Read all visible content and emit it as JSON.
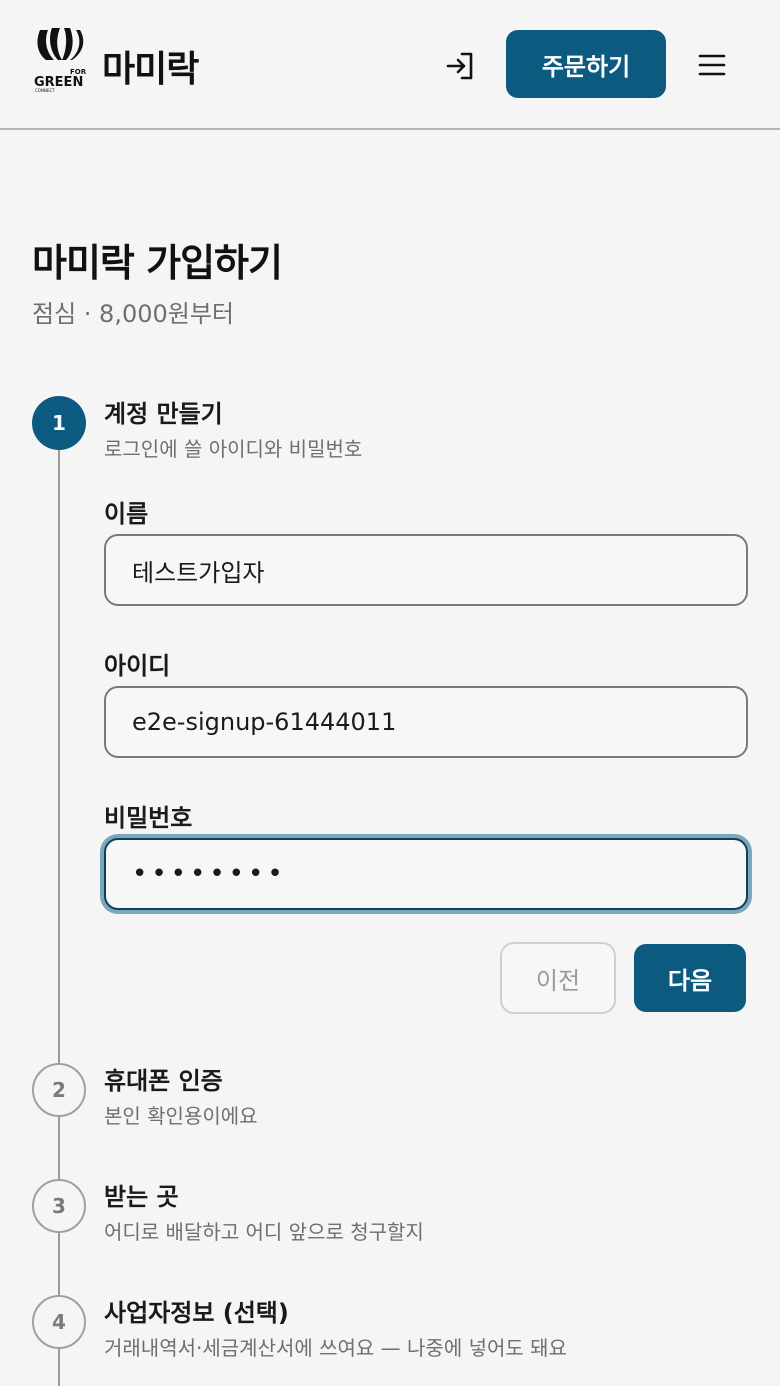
{
  "header": {
    "logo_text": "FOR GREEN CONNECT",
    "brand": "마미락",
    "order_label": "주문하기",
    "login_icon": "login-icon",
    "menu_icon": "hamburger-menu-icon"
  },
  "page": {
    "title": "마미락 가입하기",
    "subtitle": "점심 · 8,000원부터"
  },
  "steps": [
    {
      "number": "1",
      "title": "계정 만들기",
      "desc": "로그인에 쓸 아이디와 비밀번호",
      "state": "active"
    },
    {
      "number": "2",
      "title": "휴대폰 인증",
      "desc": "본인 확인용이에요",
      "state": "pending"
    },
    {
      "number": "3",
      "title": "받는 곳",
      "desc": "어디로 배달하고 어디 앞으로 청구할지",
      "state": "pending"
    },
    {
      "number": "4",
      "title": "사업자정보 (선택)",
      "desc": "거래내역서·세금계산서에 쓰여요 — 나중에 넣어도 돼요",
      "state": "pending"
    }
  ],
  "form": {
    "name_label": "이름",
    "name_value": "테스트가입자",
    "id_label": "아이디",
    "id_value": "e2e-signup-61444011",
    "password_label": "비밀번호",
    "password_value": "••••••••",
    "prev_label": "이전",
    "next_label": "다음"
  },
  "colors": {
    "accent": "#0d5a80",
    "background": "#f5f5f5",
    "muted_text": "#6f6f6f"
  }
}
